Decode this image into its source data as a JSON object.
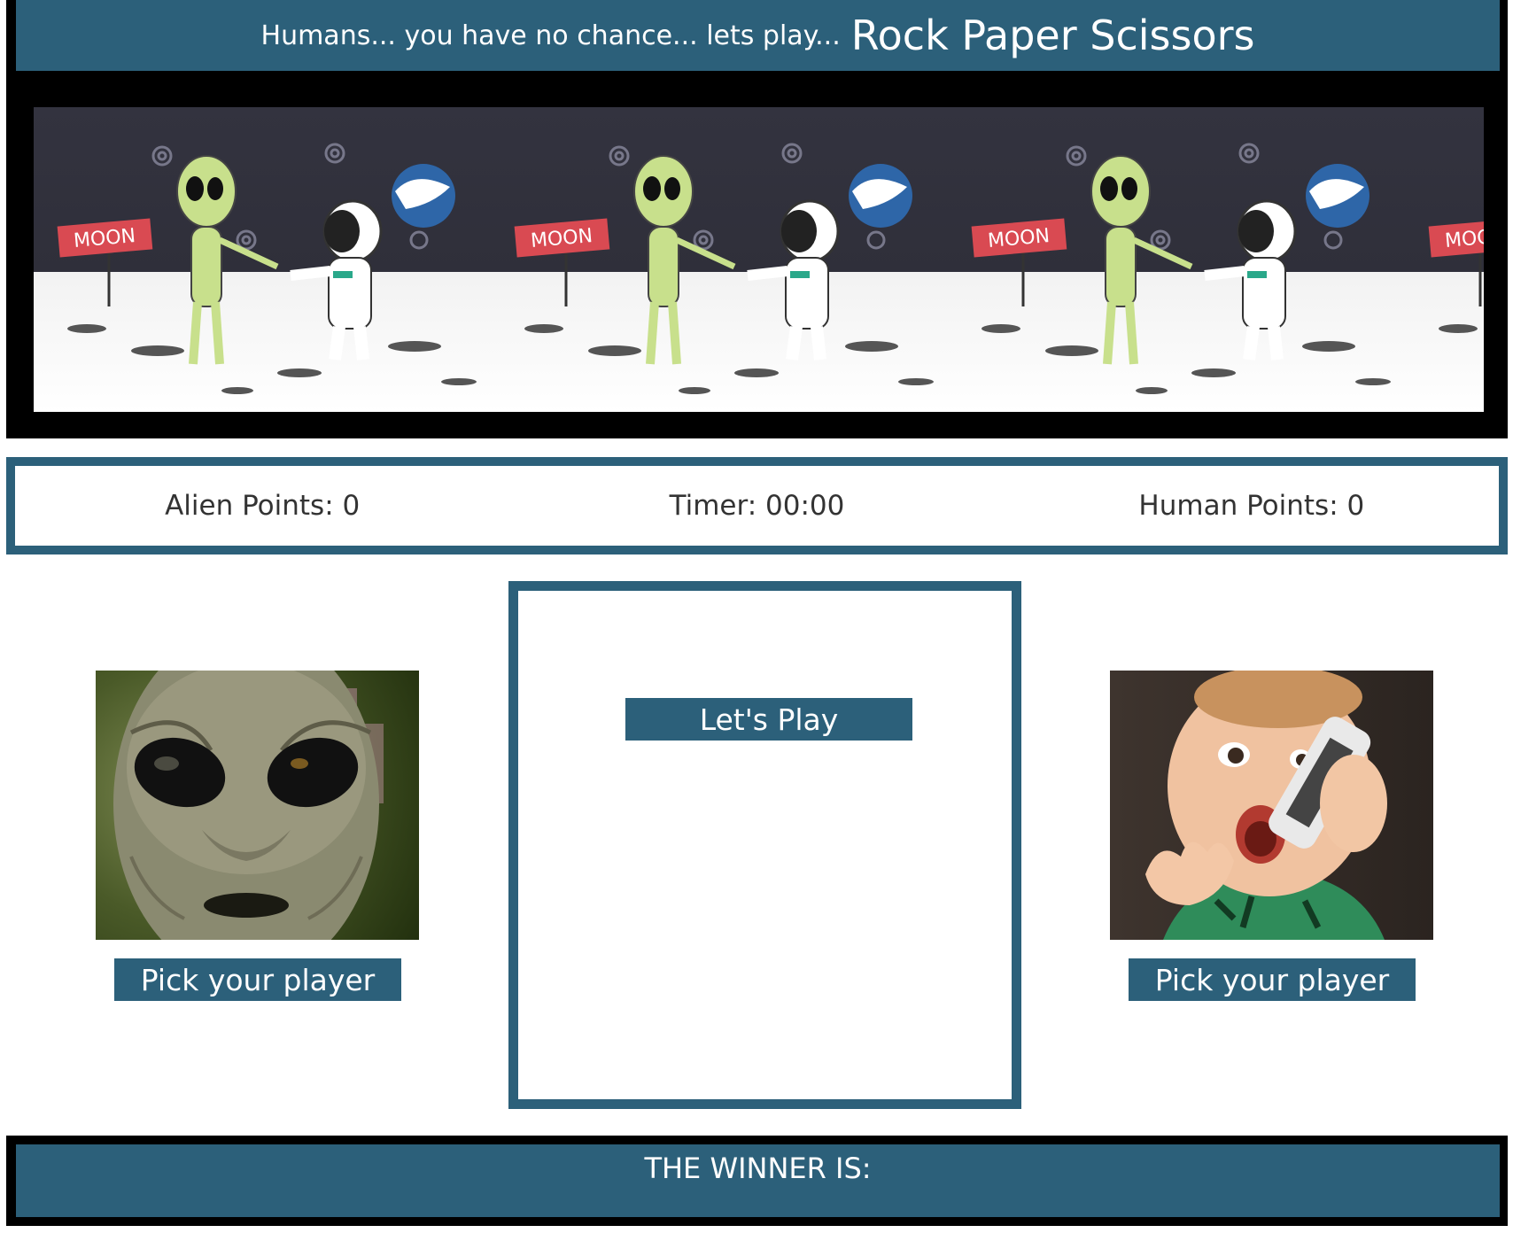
{
  "header": {
    "subtitle": "Humans... you have no chance... lets play...",
    "title": "Rock Paper Scissors"
  },
  "banner": {
    "sign_text": "MOON",
    "tile_count": 4
  },
  "stats": {
    "alien_points": "Alien Points: 0",
    "timer": "Timer: 00:00",
    "human_points": "Human Points: 0"
  },
  "players": {
    "alien": {
      "pick_label": "Pick your player",
      "image_icon": "alien-face-icon"
    },
    "human": {
      "pick_label": "Pick your player",
      "image_icon": "baby-on-phone-icon"
    }
  },
  "play": {
    "button_label": "Let's Play"
  },
  "footer": {
    "winner_label": "THE WINNER IS:"
  },
  "colors": {
    "accent": "#2c607a",
    "frame": "#000000",
    "text_on_accent": "#ffffff",
    "stat_text": "#333333"
  }
}
